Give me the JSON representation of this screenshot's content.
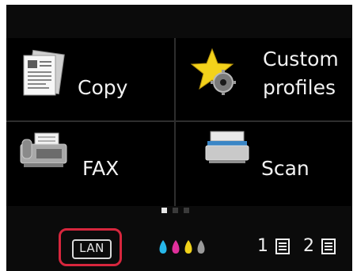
{
  "tiles": [
    {
      "id": "copy",
      "label": "Copy",
      "icon": "copy-document-icon"
    },
    {
      "id": "custom-profiles",
      "label_line1": "Custom",
      "label_line2": "profiles",
      "icon": "star-gear-icon"
    },
    {
      "id": "fax",
      "label": "FAX",
      "icon": "fax-machine-icon"
    },
    {
      "id": "scan",
      "label": "Scan",
      "icon": "scanner-icon"
    }
  ],
  "pager": {
    "pages": 3,
    "current": 1
  },
  "status": {
    "lan_label": "LAN",
    "ink_colors": [
      "#27b7e9",
      "#e0309b",
      "#f0d21a",
      "#9a9a9a"
    ],
    "trays": [
      {
        "label": "1",
        "icon": "paper-tray-icon"
      },
      {
        "label": "2",
        "icon": "paper-tray-icon"
      }
    ]
  },
  "colors": {
    "background": "#0b0b0b",
    "highlight": "#d7263d"
  }
}
